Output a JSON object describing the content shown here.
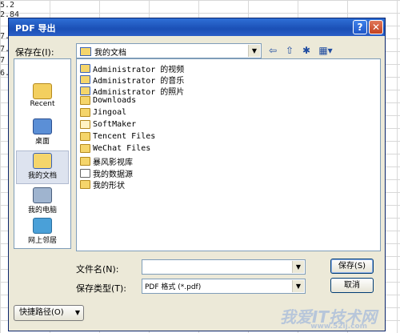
{
  "background_sheet": {
    "cells": [
      "5.2",
      "2.84",
      "7.",
      "7.",
      "7",
      "6."
    ]
  },
  "dialog": {
    "title": "PDF 导出",
    "help_label": "?",
    "close_label": "✕",
    "save_in_label": "保存在(I):",
    "save_in_value": "我的文档",
    "places": [
      {
        "label": "Recent",
        "icon": "recent-folder-icon"
      },
      {
        "label": "桌面",
        "icon": "desktop-icon"
      },
      {
        "label": "我的文档",
        "icon": "my-documents-icon"
      },
      {
        "label": "我的电脑",
        "icon": "my-computer-icon"
      },
      {
        "label": "网上邻居",
        "icon": "network-icon"
      }
    ],
    "files": [
      {
        "name": "Administrator 的视频",
        "icon": "sys"
      },
      {
        "name": "Administrator 的音乐",
        "icon": "sys"
      },
      {
        "name": "Administrator 的照片",
        "icon": "sys"
      },
      {
        "name": "Downloads",
        "icon": "folder"
      },
      {
        "name": "Jingoal",
        "icon": "folder"
      },
      {
        "name": "SoftMaker",
        "icon": "light"
      },
      {
        "name": "Tencent Files",
        "icon": "folder"
      },
      {
        "name": "WeChat Files",
        "icon": "folder"
      },
      {
        "name": "暴风影视库",
        "icon": "folder"
      },
      {
        "name": "我的数据源",
        "icon": "data"
      },
      {
        "name": "我的形状",
        "icon": "folder"
      }
    ],
    "filename_label": "文件名(N):",
    "filename_value": "",
    "filetype_label": "保存类型(T):",
    "filetype_value": "PDF 格式 (*.pdf)",
    "save_button": "保存(S)",
    "cancel_button": "取消",
    "shortcut_button": "快捷路径(O)"
  },
  "watermark": {
    "text": "我爱IT技术网",
    "url": "www.52ij.com"
  },
  "colors": {
    "title_bar": "#2160cf",
    "dialog_bg": "#ece9d8",
    "border": "#7f9db9",
    "selection": "#dde3ef"
  }
}
